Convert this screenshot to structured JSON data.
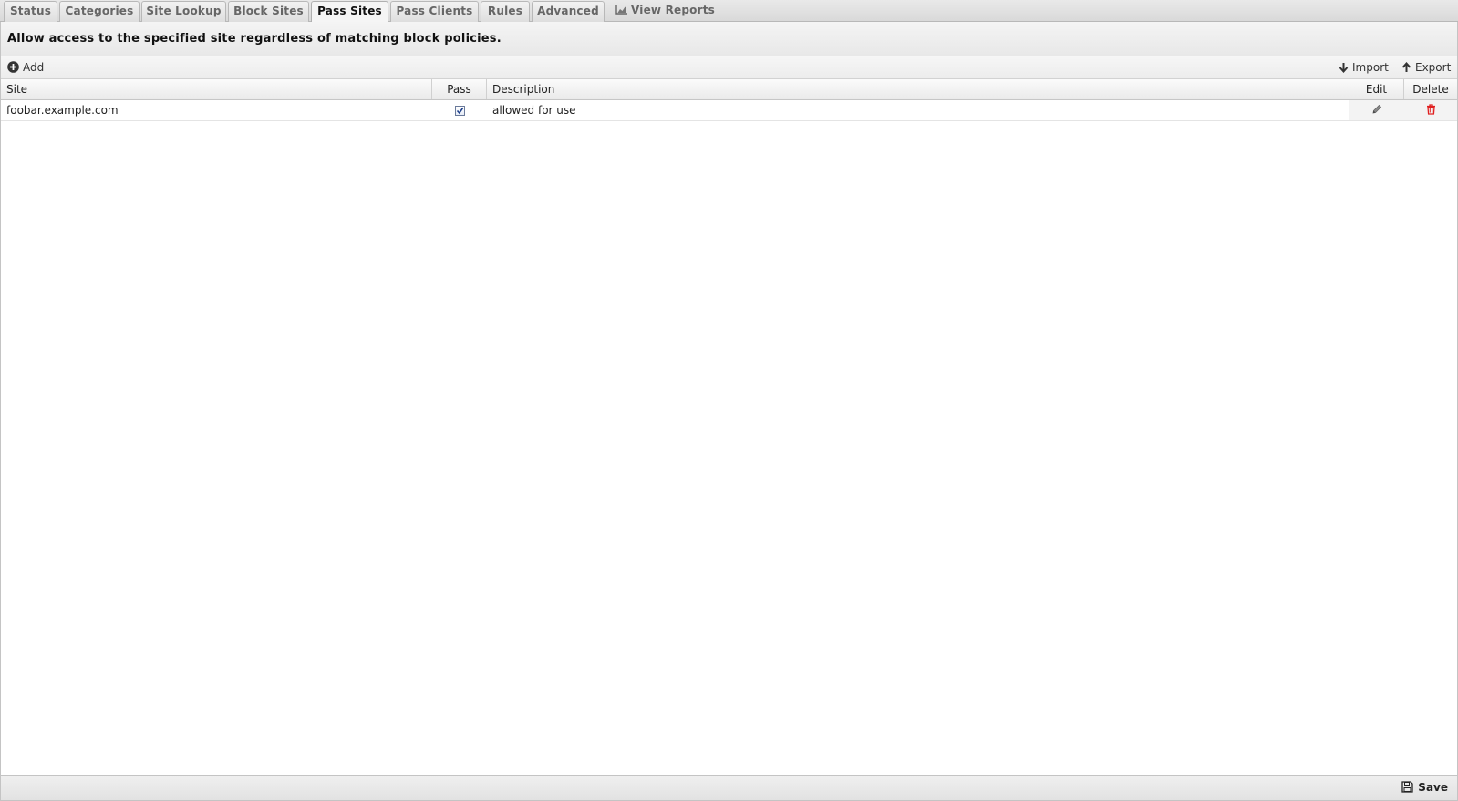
{
  "tabs": [
    {
      "label": "Status",
      "active": false
    },
    {
      "label": "Categories",
      "active": false
    },
    {
      "label": "Site Lookup",
      "active": false
    },
    {
      "label": "Block Sites",
      "active": false
    },
    {
      "label": "Pass Sites",
      "active": true
    },
    {
      "label": "Pass Clients",
      "active": false
    },
    {
      "label": "Rules",
      "active": false
    },
    {
      "label": "Advanced",
      "active": false
    },
    {
      "label": "View Reports",
      "active": false,
      "icon": "chart-icon"
    }
  ],
  "description": "Allow access to the specified site regardless of matching block policies.",
  "toolbar": {
    "add_label": "Add",
    "import_label": "Import",
    "export_label": "Export"
  },
  "table": {
    "columns": {
      "site": "Site",
      "pass": "Pass",
      "description": "Description",
      "edit": "Edit",
      "delete": "Delete"
    },
    "rows": [
      {
        "site": "foobar.example.com",
        "pass": true,
        "description": "allowed for use"
      }
    ]
  },
  "footer": {
    "save_label": "Save"
  },
  "colors": {
    "delete_icon": "#e02020",
    "edit_icon": "#777777"
  }
}
